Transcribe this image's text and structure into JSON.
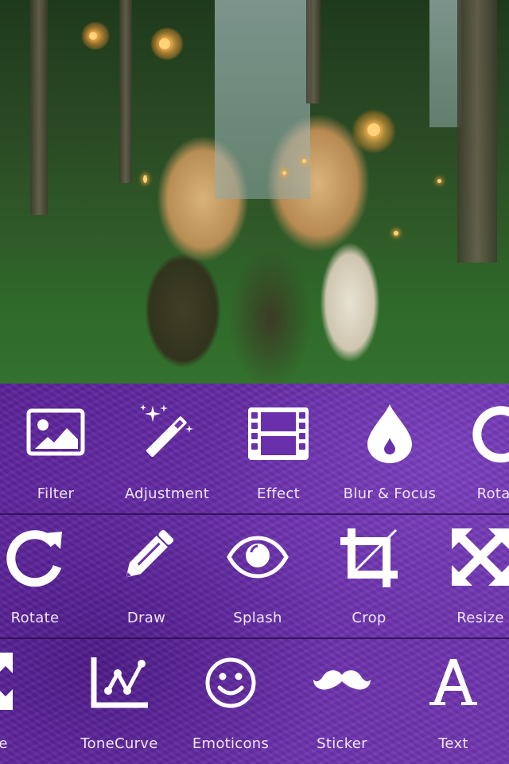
{
  "photo": {
    "description": "Two women holding sparklers in a forest"
  },
  "toolbar": {
    "rows": [
      {
        "items": [
          {
            "label": "Filter",
            "icon": "image-icon"
          },
          {
            "label": "Adjustment",
            "icon": "magic-wand-icon"
          },
          {
            "label": "Effect",
            "icon": "film-icon"
          },
          {
            "label": "Blur & Focus",
            "icon": "drop-icon"
          },
          {
            "label": "Rotate",
            "icon": "rotate-icon"
          }
        ]
      },
      {
        "items": [
          {
            "label": "Rotate",
            "icon": "rotate-icon"
          },
          {
            "label": "Draw",
            "icon": "pencil-icon"
          },
          {
            "label": "Splash",
            "icon": "eye-icon"
          },
          {
            "label": "Crop",
            "icon": "crop-icon"
          },
          {
            "label": "Resize",
            "icon": "resize-icon"
          }
        ]
      },
      {
        "items": [
          {
            "label": "Resize",
            "icon": "resize-icon"
          },
          {
            "label": "ToneCurve",
            "icon": "tone-curve-icon"
          },
          {
            "label": "Emoticons",
            "icon": "smiley-icon"
          },
          {
            "label": "Sticker",
            "icon": "mustache-icon"
          },
          {
            "label": "Text",
            "icon": "text-icon"
          }
        ]
      }
    ]
  },
  "colors": {
    "panel": "#6a30ac",
    "icon": "#ffffff",
    "label": "#efe6f7",
    "divider": "#2a0c4a"
  }
}
